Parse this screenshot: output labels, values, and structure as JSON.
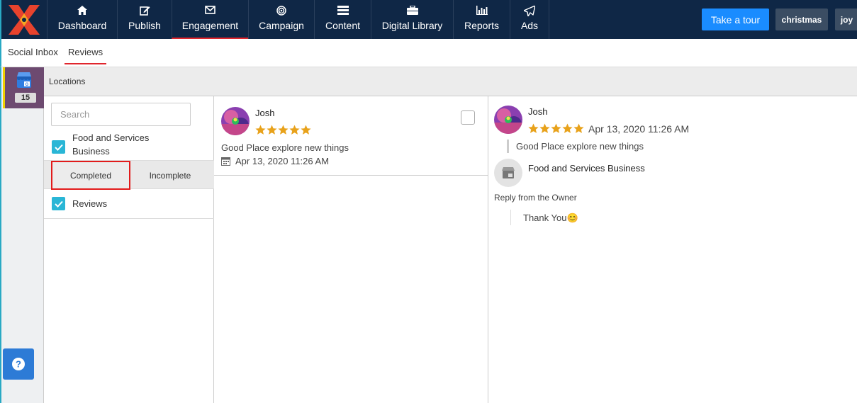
{
  "nav": {
    "items": [
      {
        "label": "Dashboard",
        "icon": "home-icon"
      },
      {
        "label": "Publish",
        "icon": "edit-icon"
      },
      {
        "label": "Engagement",
        "icon": "envelope-icon"
      },
      {
        "label": "Campaign",
        "icon": "target-icon"
      },
      {
        "label": "Content",
        "icon": "list-icon"
      },
      {
        "label": "Digital Library",
        "icon": "briefcase-icon"
      },
      {
        "label": "Reports",
        "icon": "bar-chart-icon"
      },
      {
        "label": "Ads",
        "icon": "paper-plane-icon"
      }
    ],
    "active": "Engagement",
    "tour_label": "Take a tour",
    "workspace": "christmas",
    "user": "joy"
  },
  "subnav": {
    "tabs": [
      "Social Inbox",
      "Reviews"
    ],
    "active": "Reviews"
  },
  "sidebar": {
    "badge_count": "15",
    "accent": "#6d4a70"
  },
  "locations": {
    "header": "Locations",
    "search_placeholder": "Search",
    "location_label": "Food and Services Business",
    "toggle": [
      "Completed",
      "Incomplete"
    ],
    "toggle_selected": "Completed",
    "reviews_label": "Reviews"
  },
  "review": {
    "author": "Josh",
    "rating": 5,
    "text": "Good Place explore new things",
    "date": "Apr 13, 2020 11:26 AM"
  },
  "detail": {
    "author": "Josh",
    "date": "Apr 13, 2020 11:26 AM",
    "text": "Good Place explore new things",
    "business": "Food and Services Business",
    "reply_heading": "Reply from the Owner",
    "reply_text": "Thank You😊"
  },
  "colors": {
    "nav_bg": "#0f2746",
    "accent_red": "#e0262d",
    "primary_blue": "#1a8cff",
    "check_cyan": "#29b6d6",
    "star": "#e8a21b"
  }
}
